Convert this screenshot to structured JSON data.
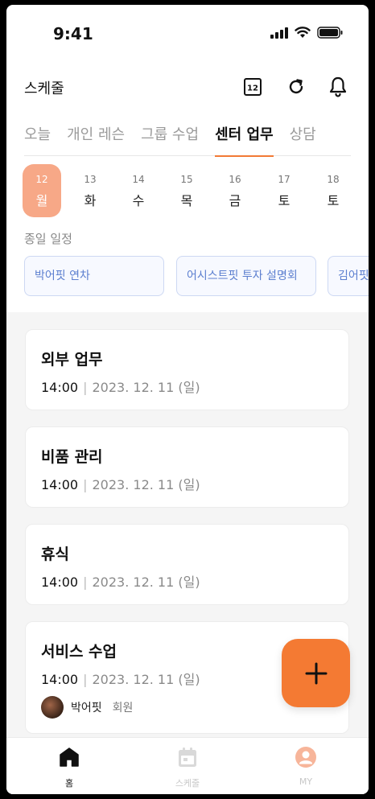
{
  "status_bar": {
    "time": "9:41"
  },
  "header": {
    "title": "스케줄",
    "calendar_badge": "12"
  },
  "tabs": [
    {
      "label": "오늘",
      "active": false
    },
    {
      "label": "개인 레슨",
      "active": false
    },
    {
      "label": "그룹 수업",
      "active": false
    },
    {
      "label": "센터 업무",
      "active": true
    },
    {
      "label": "상담",
      "active": false
    }
  ],
  "days": [
    {
      "num": "12",
      "weekday": "월",
      "selected": true
    },
    {
      "num": "13",
      "weekday": "화",
      "selected": false
    },
    {
      "num": "14",
      "weekday": "수",
      "selected": false
    },
    {
      "num": "15",
      "weekday": "목",
      "selected": false
    },
    {
      "num": "16",
      "weekday": "금",
      "selected": false
    },
    {
      "num": "17",
      "weekday": "토",
      "selected": false
    },
    {
      "num": "18",
      "weekday": "토",
      "selected": false
    }
  ],
  "all_day": {
    "label": "종일 일정",
    "events": [
      "박어핏 연차",
      "어시스트핏 투자 설명회",
      "김어핏"
    ]
  },
  "tasks": [
    {
      "title": "외부 업무",
      "time": "14:00",
      "date": "2023. 12. 11 (일)"
    },
    {
      "title": "비품 관리",
      "time": "14:00",
      "date": "2023. 12. 11 (일)"
    },
    {
      "title": "휴식",
      "time": "14:00",
      "date": "2023. 12. 11 (일)"
    },
    {
      "title": "서비스 수업",
      "time": "14:00",
      "date": "2023. 12. 11 (일)",
      "member_name": "박어핏",
      "member_role": "회원"
    }
  ],
  "bottom_nav": [
    {
      "label": "홈",
      "icon": "home-icon",
      "active": true
    },
    {
      "label": "스케줄",
      "icon": "calendar-icon",
      "active": false
    },
    {
      "label": "MY",
      "icon": "profile-icon",
      "active": false
    }
  ],
  "colors": {
    "accent": "#f47a33",
    "selected_day": "#f7a887",
    "chip_text": "#5c7fcf",
    "chip_border": "#cdd8f3"
  }
}
